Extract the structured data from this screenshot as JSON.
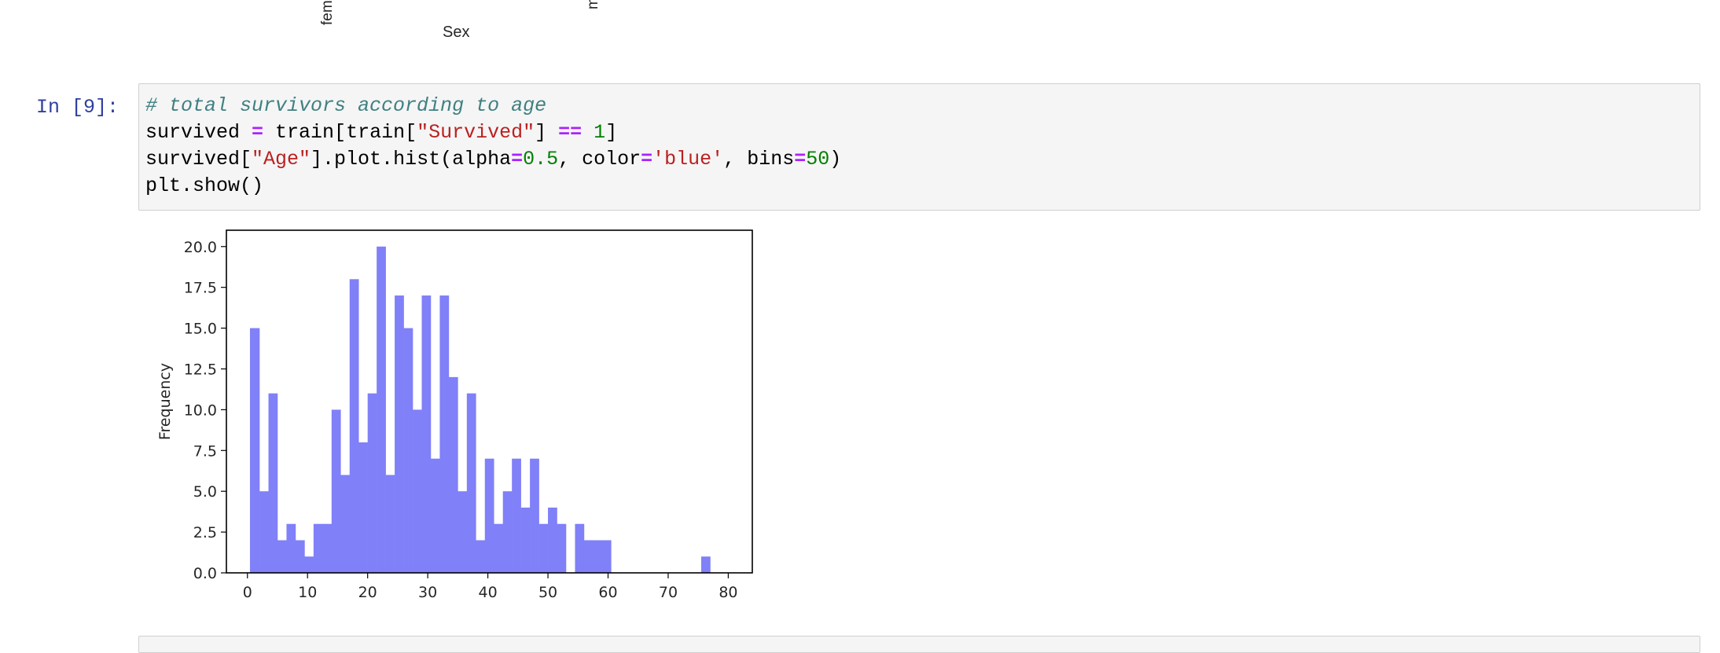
{
  "previous_output": {
    "tick_labels": [
      "fem",
      "m"
    ],
    "xlabel": "Sex"
  },
  "cell": {
    "prompt": "In [9]:",
    "code": {
      "line1": "# total survivors according to age",
      "line2": {
        "a": "survived ",
        "op1": "=",
        "b": " train[train[",
        "str": "\"Survived\"",
        "c": "] ",
        "op2": "==",
        "d": " ",
        "num": "1",
        "e": "]"
      },
      "line3": {
        "a": "survived[",
        "str1": "\"Age\"",
        "b": "].plot.hist(alpha",
        "op1": "=",
        "num1": "0.5",
        "c": ", color",
        "op2": "=",
        "str2": "'blue'",
        "d": ", bins",
        "op3": "=",
        "num2": "50",
        "e": ")"
      },
      "line4": "plt.show()"
    }
  },
  "chart_data": {
    "type": "bar",
    "subtype": "histogram",
    "color": "#8080f8",
    "x": [
      0.42,
      2.0,
      3.5,
      5.0,
      6.5,
      8.0,
      9.5,
      11.0,
      12.5,
      14.0,
      15.5,
      17.0,
      18.5,
      20.0,
      21.5,
      23.0,
      24.5,
      26.0,
      27.5,
      29.0,
      30.5,
      32.0,
      33.5,
      35.0,
      36.5,
      38.0,
      39.5,
      41.0,
      42.5,
      44.0,
      45.5,
      47.0,
      48.5,
      50.0,
      51.5,
      53.0,
      54.5,
      56.0,
      57.5,
      59.0,
      60.5,
      62.0,
      63.5,
      65.0,
      66.5,
      68.0,
      69.5,
      71.0,
      72.5,
      74.0,
      75.5,
      77.0,
      78.5,
      80.0
    ],
    "values": [
      15,
      5,
      11,
      2,
      3,
      2,
      1,
      3,
      3,
      10,
      6,
      18,
      8,
      11,
      20,
      6,
      17,
      15,
      10,
      17,
      7,
      17,
      12,
      5,
      11,
      2,
      7,
      3,
      5,
      7,
      4,
      7,
      3,
      4,
      3,
      0,
      3,
      2,
      2,
      2,
      0,
      0,
      0,
      0,
      0,
      0,
      0,
      0,
      0,
      0,
      1
    ],
    "xlim": [
      -3.5,
      84.0
    ],
    "ylim": [
      0,
      21.0
    ],
    "xticks": [
      0,
      10,
      20,
      30,
      40,
      50,
      60,
      70,
      80
    ],
    "yticks": [
      0.0,
      2.5,
      5.0,
      7.5,
      10.0,
      12.5,
      15.0,
      17.5,
      20.0
    ],
    "ytick_labels": [
      "0.0",
      "2.5",
      "5.0",
      "7.5",
      "10.0",
      "12.5",
      "15.0",
      "17.5",
      "20.0"
    ],
    "xlabel": "",
    "ylabel": "Frequency"
  }
}
